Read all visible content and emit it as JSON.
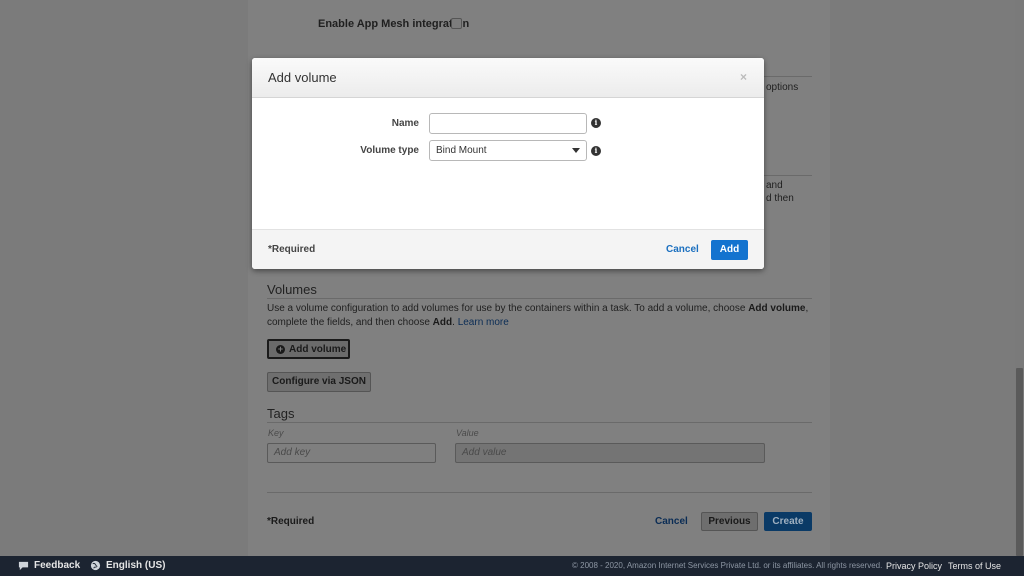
{
  "background": {
    "app_mesh_label": "Enable App Mesh integration",
    "side_text_1": "options",
    "side_text_2": "and",
    "side_text_3": "d then",
    "volumes": {
      "title": "Volumes",
      "desc_part1": "Use a volume configuration to add volumes for use by the containers within a task. To add a volume, choose ",
      "desc_bold1": "Add volume",
      "desc_part2": ", complete the fields, and then choose ",
      "desc_bold2": "Add",
      "desc_part3": ". ",
      "learn_more": "Learn more",
      "add_volume_label": "Add volume",
      "configure_json_label": "Configure via JSON"
    },
    "tags": {
      "title": "Tags",
      "key_label": "Key",
      "value_label": "Value",
      "key_placeholder": "Add key",
      "value_placeholder": "Add value"
    },
    "footer_actions": {
      "required": "*Required",
      "cancel": "Cancel",
      "previous": "Previous",
      "create": "Create"
    }
  },
  "modal": {
    "title": "Add volume",
    "close": "×",
    "name_label": "Name",
    "name_value": "",
    "volume_type_label": "Volume type",
    "volume_type_value": "Bind Mount",
    "required": "*Required",
    "cancel": "Cancel",
    "add": "Add"
  },
  "footer": {
    "feedback": "Feedback",
    "language": "English (US)",
    "copyright": "© 2008 - 2020, Amazon Internet Services Private Ltd. or its affiliates. All rights reserved.",
    "privacy": "Privacy Policy",
    "terms": "Terms of Use"
  },
  "colors": {
    "primary": "#1373cf",
    "footer_bg": "#1c2431",
    "overlay": "#7a7a7a"
  },
  "icons": {
    "info": "info-icon",
    "dropdown": "caret-down-icon",
    "close": "close-icon",
    "plus": "plus-circle-icon",
    "feedback": "speech-bubble-icon",
    "globe": "globe-icon"
  }
}
